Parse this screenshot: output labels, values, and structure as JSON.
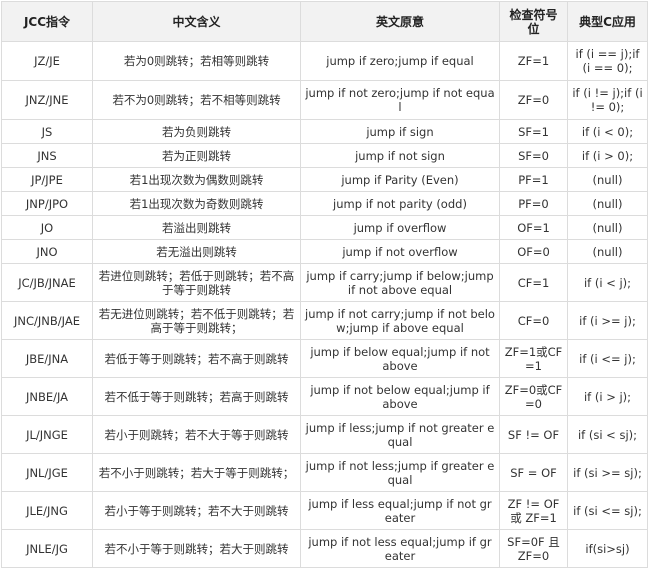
{
  "table": {
    "headers": [
      "JCC指令",
      "中文含义",
      "英文原意",
      "检查符号位",
      "典型C应用"
    ],
    "rows": [
      {
        "h": "s2",
        "cells": [
          "JZ/JE",
          "若为0则跳转；若相等则跳转",
          "jump if zero;jump if equal",
          "ZF=1",
          "if (i == j);if (i == 0);"
        ]
      },
      {
        "h": "s2",
        "cells": [
          "JNZ/JNE",
          "若不为0则跳转；若不相等则跳转",
          "jump if not zero;jump if not equal",
          "ZF=0",
          "if (i != j);if (i != 0);"
        ]
      },
      {
        "h": "s",
        "cells": [
          "JS",
          "若为负则跳转",
          "jump if sign",
          "SF=1",
          "if (i < 0);"
        ]
      },
      {
        "h": "s",
        "cells": [
          "JNS",
          "若为正则跳转",
          "jump if not sign",
          "SF=0",
          "if (i > 0);"
        ]
      },
      {
        "h": "s",
        "cells": [
          "JP/JPE",
          "若1出现次数为偶数则跳转",
          "jump if Parity (Even)",
          "PF=1",
          "(null)"
        ]
      },
      {
        "h": "s",
        "cells": [
          "JNP/JPO",
          "若1出现次数为奇数则跳转",
          "jump if not parity (odd)",
          "PF=0",
          "(null)"
        ]
      },
      {
        "h": "s",
        "cells": [
          "JO",
          "若溢出则跳转",
          "jump if overflow",
          "OF=1",
          "(null)"
        ]
      },
      {
        "h": "s",
        "cells": [
          "JNO",
          "若无溢出则跳转",
          "jump if not overflow",
          "OF=0",
          "(null)"
        ]
      },
      {
        "h": "t",
        "cells": [
          "JC/JB/JNAE",
          "若进位则跳转；若低于则跳转；若不高于等于则跳转",
          "jump if carry;jump if below;jump if not above equal",
          "CF=1",
          "if (i < j);"
        ]
      },
      {
        "h": "t",
        "cells": [
          "JNC/JNB/JAE",
          "若无进位则跳转；若不低于则跳转；若高于等于则跳转；",
          "jump if not carry;jump if not below;jump if above equal",
          "CF=0",
          "if (i >= j);"
        ]
      },
      {
        "h": "t",
        "cells": [
          "JBE/JNA",
          "若低于等于则跳转；若不高于则跳转",
          "jump if below equal;jump if not above",
          "ZF=1或CF=1",
          "if (i <= j);"
        ]
      },
      {
        "h": "t",
        "cells": [
          "JNBE/JA",
          "若不低于等于则跳转；若高于则跳转",
          "jump if not below equal;jump if above",
          "ZF=0或CF=0",
          "if (i > j);"
        ]
      },
      {
        "h": "t",
        "cells": [
          "JL/JNGE",
          "若小于则跳转；若不大于等于则跳转",
          "jump if less;jump if not greater equal",
          "SF != OF",
          "if (si < sj);"
        ]
      },
      {
        "h": "t",
        "cells": [
          "JNL/JGE",
          "若不小于则跳转；若大于等于则跳转；",
          "jump if not less;jump if greater equal",
          "SF = OF",
          "if (si >= sj);"
        ]
      },
      {
        "h": "t",
        "cells": [
          "JLE/JNG",
          "若小于等于则跳转；若不大于则跳转",
          "jump if less equal;jump if not greater",
          "ZF != OF 或 ZF=1",
          "if (si <= sj);"
        ]
      },
      {
        "h": "t",
        "cells": [
          "JNLE/JG",
          "若不小于等于则跳转；若大于则跳转",
          "jump if not less equal;jump if greater",
          "SF=0F 且 ZF=0",
          "if(si>sj)"
        ]
      }
    ]
  }
}
